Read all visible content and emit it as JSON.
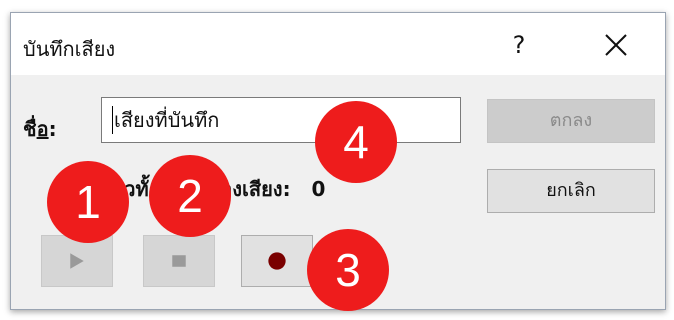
{
  "dialog": {
    "title": "บันทึกเสียง",
    "help_label": "?",
    "close_icon": "close-icon"
  },
  "form": {
    "name_label_prefix": "ชื่",
    "name_label_accel": "อ",
    "name_label_suffix": ":",
    "name_value": "เสียงที่บันทึก",
    "length_label": "าวทั้",
    "length_label_tail": "ของเสียง:",
    "length_value": "0"
  },
  "buttons": {
    "ok_label": "ตกลง",
    "cancel_label": "ยกเลิก"
  },
  "controls": {
    "play_icon": "play-icon",
    "stop_icon": "stop-icon",
    "record_icon": "record-icon"
  },
  "callouts": [
    "1",
    "2",
    "3",
    "4"
  ],
  "colors": {
    "callout": "#ee1c1c",
    "record_dot": "#7a0000",
    "disabled_glyph": "#9a9a9a"
  }
}
